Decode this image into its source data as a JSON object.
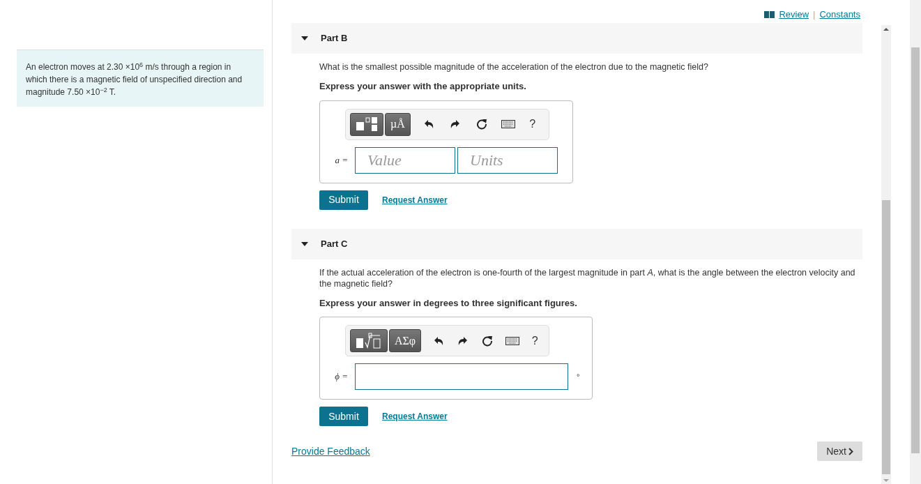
{
  "problem": {
    "text": "An electron moves at 2.30 ×10$^{6}$ m/s through a region in which there is a magnetic field of unspecified direction and magnitude 7.50 ×10$^{−2}$ T."
  },
  "top_links": [
    {
      "label": "Review"
    },
    {
      "label": "Constants"
    }
  ],
  "link_separator": "|",
  "parts": [
    {
      "title": "Part B",
      "expanded": true,
      "question": "What is the smallest possible magnitude of the acceleration of the electron due to the magnetic field?",
      "instruction": "Express your answer with the appropriate units.",
      "toolbar": {
        "kind": "fraction",
        "symbols": "µÅ",
        "help": "?"
      },
      "variable": "a =",
      "placeholders": [
        "Value",
        "Units"
      ],
      "submit": "Submit",
      "request": "Request Answer"
    },
    {
      "title": "Part C",
      "expanded": true,
      "question": "If the actual acceleration of the electron is one-fourth of the largest magnitude in part *A*, what is the angle between the electron velocity and the magnetic field?",
      "instruction": "Express your answer in degrees to three significant figures.",
      "toolbar": {
        "kind": "root",
        "symbols": "ΑΣφ",
        "help": "?"
      },
      "variable": "ϕ =",
      "unit": "°",
      "submit": "Submit",
      "request": "Request Answer"
    }
  ],
  "feedback": "Provide Feedback",
  "next": "Next"
}
